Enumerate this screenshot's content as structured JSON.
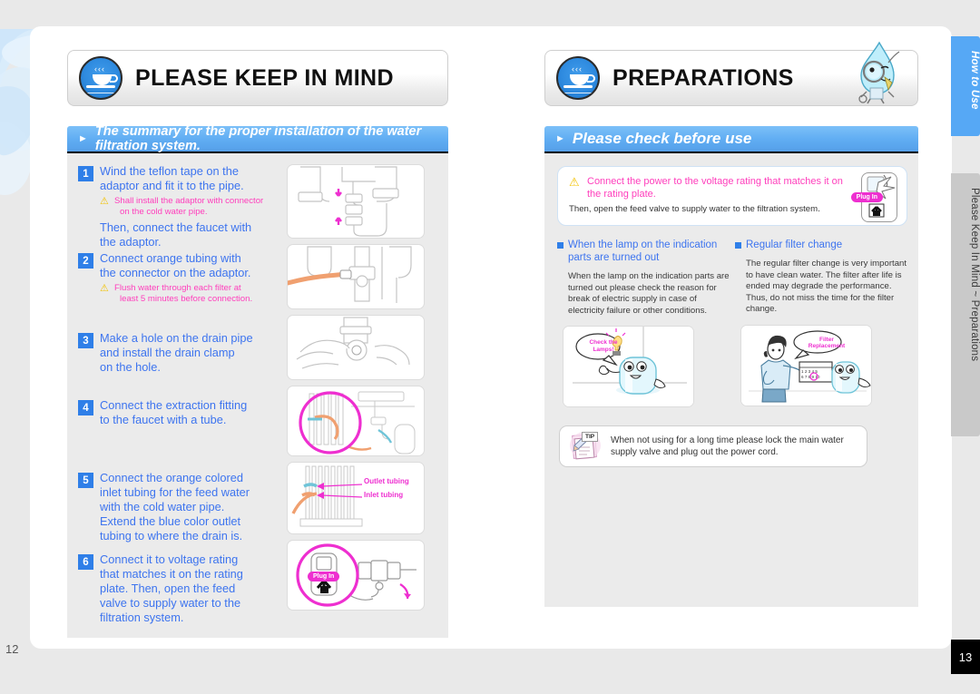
{
  "document": {
    "page_left": "12",
    "page_right": "13"
  },
  "tabs": {
    "active": "How to Use",
    "inactive": "Please Keep In Mind ~ Preparations"
  },
  "left_page": {
    "chapter_title": "PLEASE KEEP IN MIND",
    "section_bar": "The summary for the proper installation of the water filtration system.",
    "steps": [
      {
        "num": "1",
        "lines": [
          "Wind the teflon tape on the",
          "adaptor and fit it to the pipe."
        ],
        "warning": [
          "Shall install the adaptor with connector",
          "on the cold water pipe."
        ],
        "lines_after": [
          "Then, connect the faucet with",
          "the adaptor."
        ]
      },
      {
        "num": "2",
        "lines": [
          "Connect orange tubing with",
          "the connector on the adaptor."
        ],
        "warning": [
          "Flush water through each filter at",
          "least 5 minutes before connection."
        ],
        "lines_after": []
      },
      {
        "num": "3",
        "lines": [
          "Make a hole on the drain pipe",
          "and install the drain clamp",
          "on the hole."
        ],
        "warning": [],
        "lines_after": []
      },
      {
        "num": "4",
        "lines": [
          "Connect the extraction fitting",
          "to the faucet with a tube."
        ],
        "warning": [],
        "lines_after": []
      },
      {
        "num": "5",
        "lines": [
          "Connect the orange colored",
          "inlet tubing for the feed water",
          "with the cold water pipe.",
          "Extend the blue color outlet",
          "tubing to where the drain is."
        ],
        "warning": [],
        "lines_after": []
      },
      {
        "num": "6",
        "lines": [
          "Connect it to voltage rating",
          "that matches it on the rating",
          "plate. Then, open the feed",
          "valve to supply water to the",
          "filtration system."
        ],
        "warning": [],
        "lines_after": []
      }
    ],
    "illustration_labels": {
      "outlet_tubing": "Outlet tubing",
      "inlet_tubing": "Inlet tubing",
      "plug_in": "Plug In"
    }
  },
  "right_page": {
    "chapter_title": "PREPARATIONS",
    "section_bar": "Please check before use",
    "warning_box": {
      "main": "Connect the power to the voltage rating that matches it on the rating plate.",
      "sub": "Then, open the feed valve to supply water to the filtration system.",
      "plug_label": "Plug In"
    },
    "topics": [
      {
        "title": "When the lamp on the indication parts are turned out",
        "body": "When the lamp on the indication parts are turned out please check the reason for break of electric supply in case of electricity failure or other conditions.",
        "bubble": "Check the Lamps!"
      },
      {
        "title": "Regular filter change",
        "body": "The regular filter change is very important to have clean water. The filter after life is ended may degrade the performance. Thus, do not miss the time for the filter change.",
        "bubble": "Filter Replacement"
      }
    ],
    "tip": {
      "badge": "TIP",
      "text": "When not using for a long time please lock the main water supply valve and plug out the power cord."
    }
  },
  "colors": {
    "accent_blue": "#3d74ef",
    "bar_blue": "#61aef3",
    "warning_pink": "#ff3ebc",
    "magenta": "#ee2fd0",
    "tab_active": "#56a8f5",
    "tab_inactive": "#c9c9c9"
  }
}
